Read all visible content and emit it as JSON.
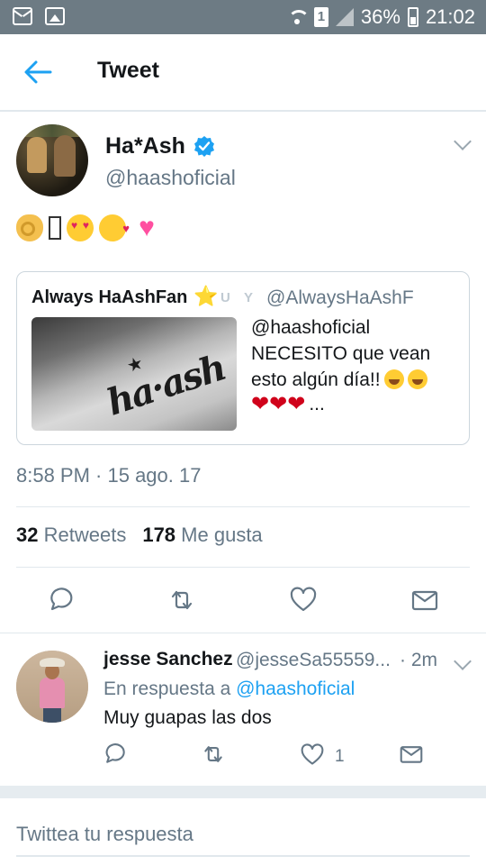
{
  "status_bar": {
    "sim_label": "1",
    "battery": "36%",
    "time": "21:02"
  },
  "header": {
    "title": "Tweet"
  },
  "tweet": {
    "author_name": "Ha*Ash",
    "author_handle": "@haashoficial",
    "emoji_icons": [
      "ok-hand-icon",
      "missing-glyph-box",
      "heart-eyes-face-icon",
      "kissing-heart-face-icon",
      "vibrating-heart-icon"
    ],
    "timestamp": "8:58 PM · 15 ago. 17",
    "retweet_count": "32",
    "retweet_label": "Retweets",
    "like_count": "178",
    "like_label": "Me gusta"
  },
  "quoted": {
    "name": "Always HaAshFan",
    "name_badges": [
      "⭐",
      "U",
      "Y"
    ],
    "handle": "@AlwaysHaAshF",
    "image_text": "ha·ash",
    "text_line1": "@haashoficial",
    "text_line2": "NECESITO que vean",
    "text_line3": "esto algún día!!",
    "hearts": "❤❤❤",
    "ellipsis": "..."
  },
  "actions": [
    "reply-icon",
    "retweet-icon",
    "like-icon",
    "direct-message-icon"
  ],
  "reply": {
    "author_name": "jesse Sanchez",
    "author_handle": "@jesseSa55559...",
    "time": "· 2m",
    "in_reply_prefix": "En respuesta a",
    "in_reply_mention": "@haashoficial",
    "text": "Muy guapas las dos",
    "like_count": "1"
  },
  "reply_input": {
    "placeholder": "Twittea tu respuesta"
  },
  "colors": {
    "status_bar": "#6d7b84",
    "twitter_blue": "#1da1f2",
    "secondary_text": "#657786",
    "divider": "#e1e8ed"
  }
}
